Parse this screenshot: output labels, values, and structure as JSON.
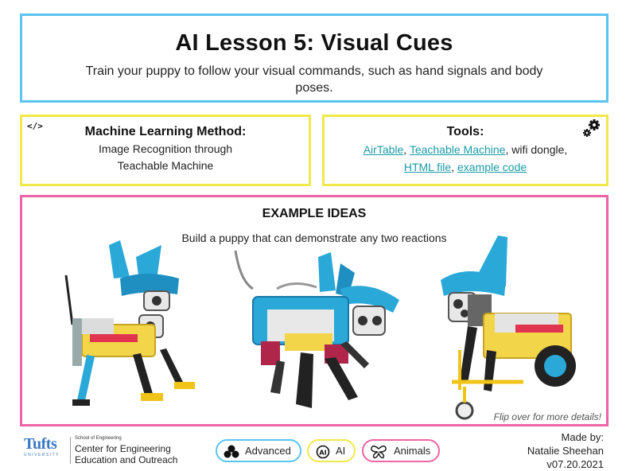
{
  "header": {
    "title": "AI Lesson 5: Visual Cues",
    "subtitle": "Train your puppy to follow your visual commands, such as hand signals and body poses."
  },
  "ml_method": {
    "title": "Machine Learning Method:",
    "line1": "Image Recognition through",
    "line2": "Teachable Machine",
    "icon": "code-icon"
  },
  "tools": {
    "title": "Tools:",
    "links": [
      "AirTable",
      "Teachable Machine",
      "HTML file",
      "example code"
    ],
    "sep1": ", ",
    "sep2": ", wifi dongle,",
    "sep3": ", ",
    "icon": "gears-icon"
  },
  "examples": {
    "title": "EXAMPLE IDEAS",
    "subtitle": "Build a puppy that can demonstrate any two reactions",
    "flip_note": "Flip over for more details!",
    "images": [
      "robot-puppy-standing",
      "robot-puppy-walking",
      "robot-puppy-wheelchair"
    ]
  },
  "footer": {
    "logo": {
      "wordmark": "Tufts",
      "university": "UNIVERSITY",
      "school": "School of Engineering",
      "center_line1": "Center for Engineering",
      "center_line2": "Education and Outreach"
    },
    "badges": [
      {
        "label": "Advanced",
        "icon": "three-dots-icon",
        "color": "#5bc4ef"
      },
      {
        "label": "AI",
        "icon": "ai-chip-icon",
        "color": "#f2e84a"
      },
      {
        "label": "Animals",
        "icon": "butterfly-icon",
        "color": "#ee64a6"
      }
    ],
    "credits": {
      "made_by": "Made by:",
      "author": "Natalie Sheehan",
      "version": "v07.20.2021"
    }
  },
  "colors": {
    "blue": "#5bc4ef",
    "yellow": "#f2e84a",
    "pink": "#ee64a6",
    "link": "#1a9ba6"
  }
}
